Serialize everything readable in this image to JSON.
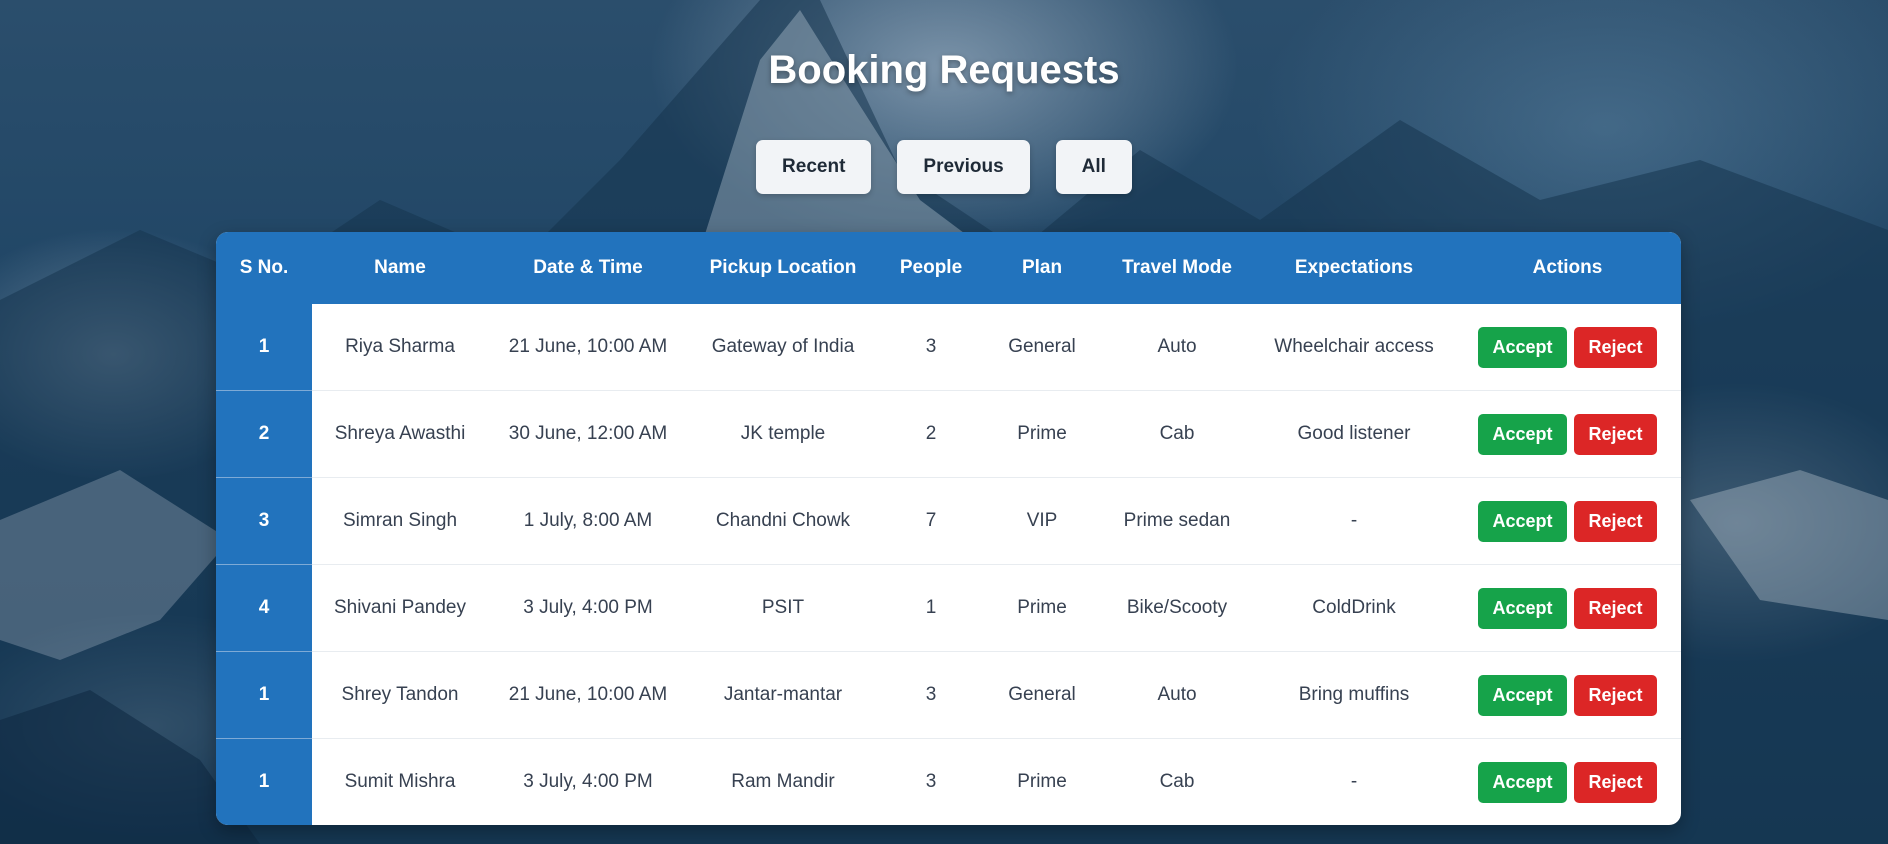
{
  "page": {
    "title": "Booking Requests"
  },
  "filters": [
    "Recent",
    "Previous",
    "All"
  ],
  "table": {
    "headers": [
      "S No.",
      "Name",
      "Date & Time",
      "Pickup Location",
      "People",
      "Plan",
      "Travel Mode",
      "Expectations",
      "Actions"
    ],
    "rows": [
      {
        "sno": "1",
        "name": "Riya Sharma",
        "datetime": "21 June, 10:00 AM",
        "pickup": "Gateway of India",
        "people": "3",
        "plan": "General",
        "mode": "Auto",
        "expectations": "Wheelchair access"
      },
      {
        "sno": "2",
        "name": "Shreya Awasthi",
        "datetime": "30 June, 12:00 AM",
        "pickup": "JK temple",
        "people": "2",
        "plan": "Prime",
        "mode": "Cab",
        "expectations": "Good listener"
      },
      {
        "sno": "3",
        "name": "Simran Singh",
        "datetime": "1 July, 8:00 AM",
        "pickup": "Chandni Chowk",
        "people": "7",
        "plan": "VIP",
        "mode": "Prime sedan",
        "expectations": "-"
      },
      {
        "sno": "4",
        "name": "Shivani Pandey",
        "datetime": "3 July, 4:00 PM",
        "pickup": "PSIT",
        "people": "1",
        "plan": "Prime",
        "mode": "Bike/Scooty",
        "expectations": "ColdDrink"
      },
      {
        "sno": "1",
        "name": "Shrey Tandon",
        "datetime": "21 June, 10:00 AM",
        "pickup": "Jantar-mantar",
        "people": "3",
        "plan": "General",
        "mode": "Auto",
        "expectations": "Bring muffins"
      },
      {
        "sno": "1",
        "name": "Sumit Mishra",
        "datetime": "3 July, 4:00 PM",
        "pickup": "Ram Mandir",
        "people": "3",
        "plan": "Prime",
        "mode": "Cab",
        "expectations": "-"
      }
    ],
    "accept_label": "Accept",
    "reject_label": "Reject"
  },
  "colors": {
    "header_blue": "#2273bd",
    "accept_green": "#16a34a",
    "reject_red": "#dc2626"
  }
}
